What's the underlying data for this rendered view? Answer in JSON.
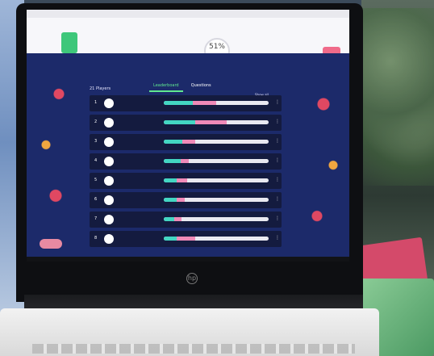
{
  "game": {
    "progress_text": "51%",
    "green_button_text": "",
    "pink_button_text": "",
    "players_label": "21 Players",
    "show_all_label": "Show all",
    "tabs": [
      {
        "label": "Leaderboard",
        "active": true
      },
      {
        "label": "Questions",
        "active": false
      }
    ],
    "rows": [
      {
        "rank": "1",
        "name": "",
        "teal": 0.28,
        "pink": 0.22
      },
      {
        "rank": "2",
        "name": "",
        "teal": 0.3,
        "pink": 0.3
      },
      {
        "rank": "3",
        "name": "",
        "teal": 0.18,
        "pink": 0.12
      },
      {
        "rank": "4",
        "name": "",
        "teal": 0.16,
        "pink": 0.08
      },
      {
        "rank": "5",
        "name": "",
        "teal": 0.12,
        "pink": 0.1
      },
      {
        "rank": "6",
        "name": "",
        "teal": 0.12,
        "pink": 0.08
      },
      {
        "rank": "7",
        "name": "",
        "teal": 0.1,
        "pink": 0.07
      },
      {
        "rank": "8",
        "name": "",
        "teal": 0.12,
        "pink": 0.18
      }
    ],
    "chat_label": ""
  },
  "colors": {
    "screen_bg": "#1c2a6a",
    "accent_green": "#60e890",
    "bar_teal": "#43d6c2",
    "bar_pink": "#f08ab8"
  }
}
